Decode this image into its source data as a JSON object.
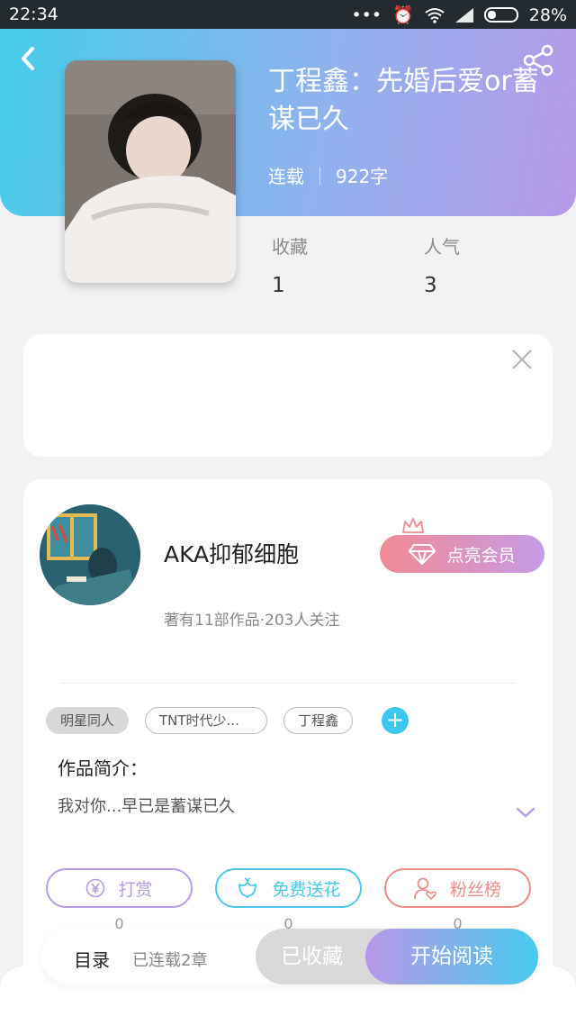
{
  "status_bar": {
    "time": "22:34",
    "battery": "28%"
  },
  "book": {
    "title": "丁程鑫：先婚后爱or蓄谋已久",
    "status": "连载",
    "word_count": "922字",
    "stats": [
      {
        "label": "收藏",
        "value": "1"
      },
      {
        "label": "人气",
        "value": "3"
      }
    ]
  },
  "author": {
    "name": "AKA抑郁细胞",
    "summary": "著有11部作品·203人关注",
    "vip_label": "点亮会员"
  },
  "tags": [
    "明星同人",
    "TNT时代少...",
    "丁程鑫"
  ],
  "intro": {
    "label": "作品简介：",
    "text": "我对你...早已是蓄谋已久"
  },
  "actions": [
    {
      "label": "打赏",
      "count": "0",
      "color": "#b89be6"
    },
    {
      "label": "免费送花",
      "count": "0",
      "color": "#48c8ea"
    },
    {
      "label": "粉丝榜",
      "count": "0",
      "color": "#ec8c88"
    }
  ],
  "bottom_bar": {
    "toc_label": "目录",
    "toc_sub": "已连载2章",
    "collected_label": "已收藏",
    "read_label": "开始阅读"
  }
}
